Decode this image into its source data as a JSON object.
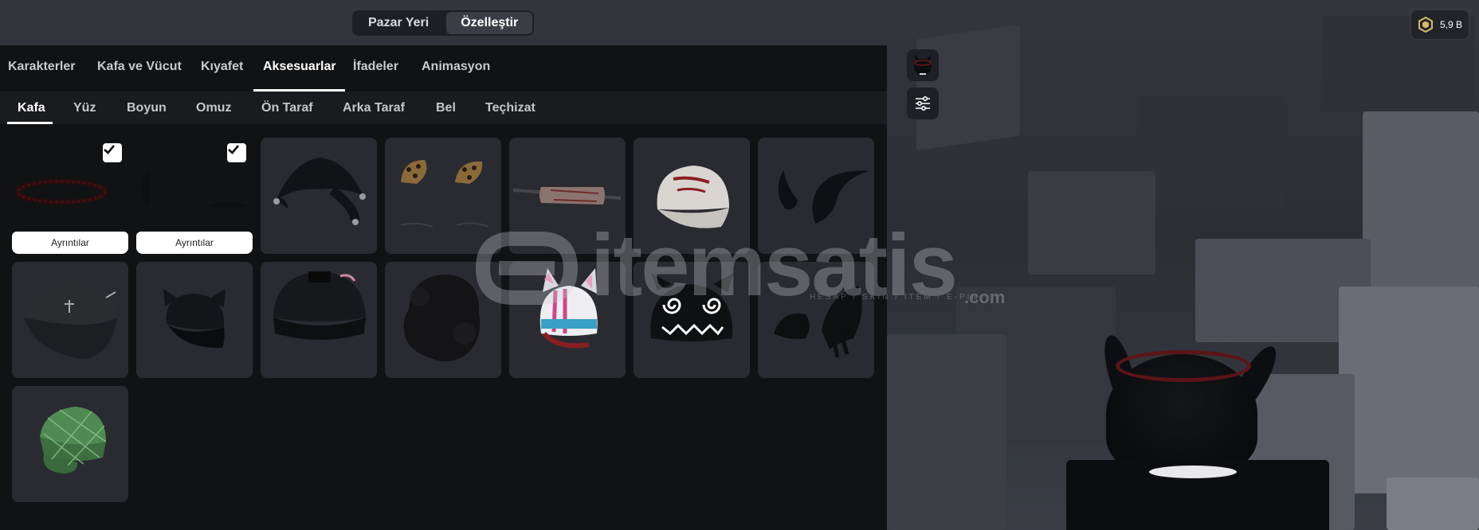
{
  "top_nav": {
    "items": [
      "Pazar Yeri",
      "Özelleştir"
    ],
    "active": "Özelleştir"
  },
  "balance": {
    "amount": "5,9 B",
    "icon": "robux-icon"
  },
  "category_tabs": {
    "items": [
      "Karakterler",
      "Kafa ve Vücut",
      "Kıyafet",
      "Aksesuarlar",
      "İfadeler",
      "Animasyon"
    ],
    "active": "Aksesuarlar"
  },
  "sub_tabs": {
    "items": [
      "Kafa",
      "Yüz",
      "Boyun",
      "Omuz",
      "Ön Taraf",
      "Arka Taraf",
      "Bel",
      "Teçhizat"
    ],
    "active": "Kafa"
  },
  "items": [
    {
      "icon": "thorn-crown-icon",
      "equipped": true,
      "details_label": "Ayrıntılar"
    },
    {
      "icon": "black-horns-icon",
      "equipped": true,
      "details_label": "Ayrıntılar"
    },
    {
      "icon": "jester-hat-icon",
      "equipped": false
    },
    {
      "icon": "leopard-ears-icon",
      "equipped": false
    },
    {
      "icon": "bandage-sword-icon",
      "equipped": false
    },
    {
      "icon": "white-cap-icon",
      "equipped": false
    },
    {
      "icon": "curved-horns-icon",
      "equipped": false
    },
    {
      "icon": "black-cross-cap-icon",
      "equipped": false
    },
    {
      "icon": "cat-ear-cap-icon",
      "equipped": false
    },
    {
      "icon": "black-helmet-icon",
      "equipped": false
    },
    {
      "icon": "fluffy-hair-icon",
      "equipped": false
    },
    {
      "icon": "bunny-helmet-icon",
      "equipped": false
    },
    {
      "icon": "spiral-eye-beanie-icon",
      "equipped": false
    },
    {
      "icon": "black-wings-icon",
      "equipped": false
    },
    {
      "icon": "green-plaid-cap-icon",
      "equipped": false
    }
  ],
  "tools": [
    "avatar-thumbnail-icon",
    "sliders-icon"
  ],
  "watermark": {
    "brand": "itemsatis",
    "tagline": "HESAP / SKIN / ITEM / E-PIN",
    "suffix": ".com"
  }
}
